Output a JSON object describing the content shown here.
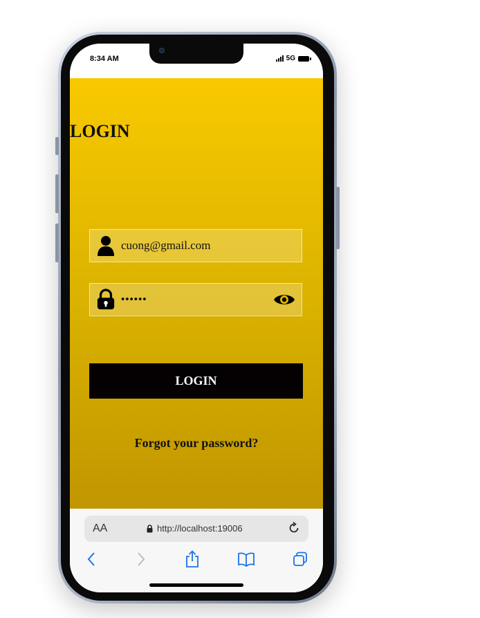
{
  "status_bar": {
    "time": "8:34 AM",
    "network": "5G",
    "icons": [
      "signal-icon",
      "battery-icon"
    ]
  },
  "login_page": {
    "title": "LOGIN",
    "email_value": "cuong@gmail.com",
    "password_value": "••••••",
    "login_button_label": "LOGIN",
    "forgot_link": "Forgot your password?",
    "icons": [
      "user-icon",
      "lock-icon",
      "eye-icon"
    ]
  },
  "browser": {
    "text_size_label": "AA",
    "url": "http://localhost:19006",
    "icons": [
      "lock-icon",
      "reload-icon",
      "back-icon",
      "forward-icon",
      "share-icon",
      "bookmarks-icon",
      "tabs-icon"
    ]
  },
  "colors": {
    "gradient_top": "#f9c900",
    "gradient_bottom": "#c19600",
    "button_bg": "#050002",
    "browser_accent": "#1a73e8"
  }
}
